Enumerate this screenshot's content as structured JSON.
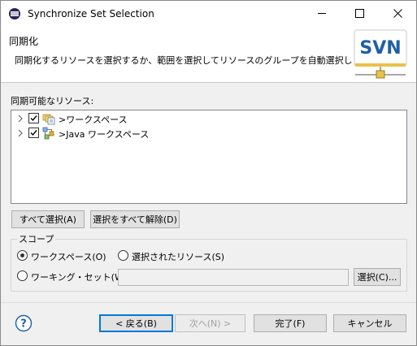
{
  "window": {
    "title": "Synchronize Set Selection",
    "controls": [
      "minimize",
      "maximize",
      "close"
    ]
  },
  "banner": {
    "title": "同期化",
    "description": "同期化するリソースを選択するか、範囲を選択してリソースのグループを自動選択します。",
    "logo_text": "SVN",
    "logo_color": "#1f5fa6"
  },
  "resources": {
    "label": "同期可能なリソース:",
    "items": [
      {
        "label": ">ワークスペース",
        "checked": true,
        "icon": "working-set-icon"
      },
      {
        "label": ">Java ワークスペース",
        "checked": true,
        "icon": "java-working-set-icon"
      }
    ]
  },
  "buttons": {
    "select_all": "すべて選択(A)",
    "deselect_all": "選択をすべて解除(D)",
    "choose": "選択(C)...",
    "back": "< 戻る(B)",
    "next": "次へ(N) >",
    "finish": "完了(F)",
    "cancel": "キャンセル"
  },
  "scope": {
    "legend": "スコープ",
    "workspace": "ワークスペース(O)",
    "selected_resources": "選択されたリソース(S)",
    "working_set": "ワーキング・セット(W):",
    "working_set_value": "",
    "selected": "workspace"
  },
  "colors": {
    "accent": "#0078d7",
    "help": "#1f5fa6"
  }
}
